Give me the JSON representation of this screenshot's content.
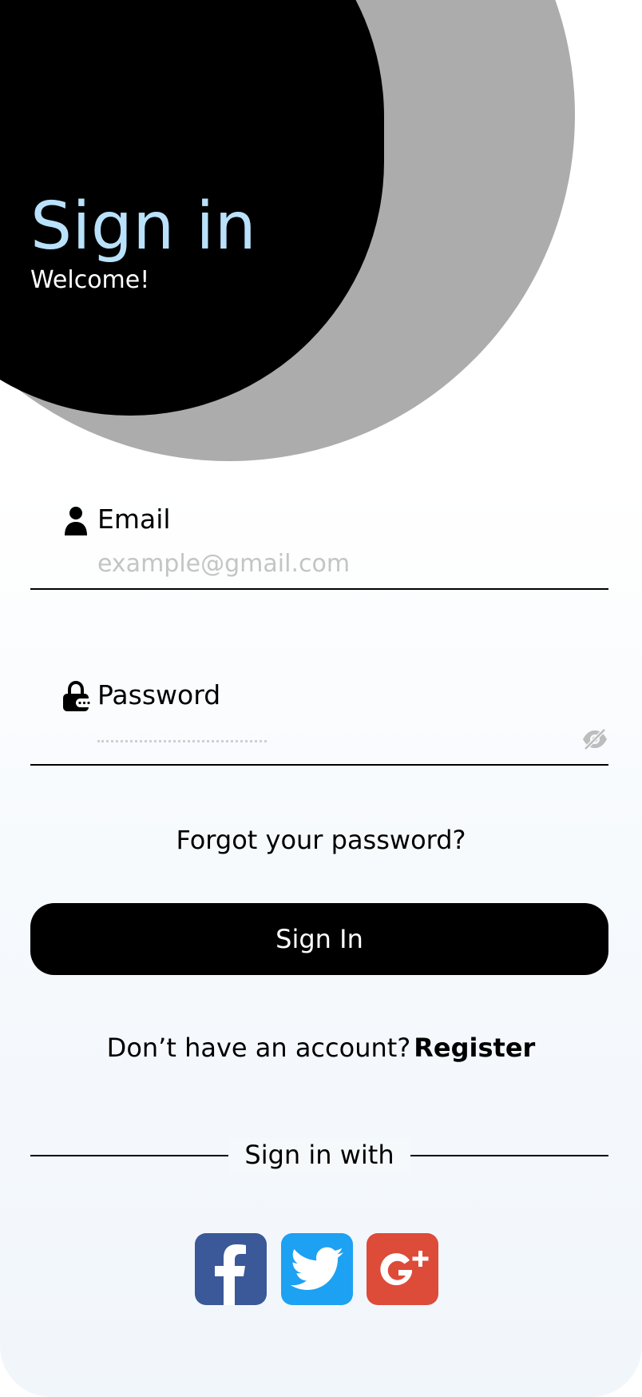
{
  "hero": {
    "title": "Sign in",
    "subtitle": "Welcome!"
  },
  "email": {
    "label": "Email",
    "placeholder": "example@gmail.com",
    "icon": "user-icon"
  },
  "password": {
    "label": "Password",
    "icon": "lock-icon",
    "toggle_icon": "eye-off-icon"
  },
  "forgot_link": "Forgot your password?",
  "signin_button": "Sign In",
  "register": {
    "prompt": "Don’t have an account?",
    "link": "Register"
  },
  "social": {
    "divider_text": "Sign in with",
    "providers": [
      {
        "name": "facebook",
        "icon": "facebook-icon",
        "color": "#3b5998"
      },
      {
        "name": "twitter",
        "icon": "twitter-icon",
        "color": "#1da1f2"
      },
      {
        "name": "google-plus",
        "icon": "google-plus-icon",
        "color": "#dd4b39"
      }
    ]
  },
  "colors": {
    "title_accent": "#b9e1fb",
    "primary": "#000000",
    "blob_gray": "#acacac"
  }
}
